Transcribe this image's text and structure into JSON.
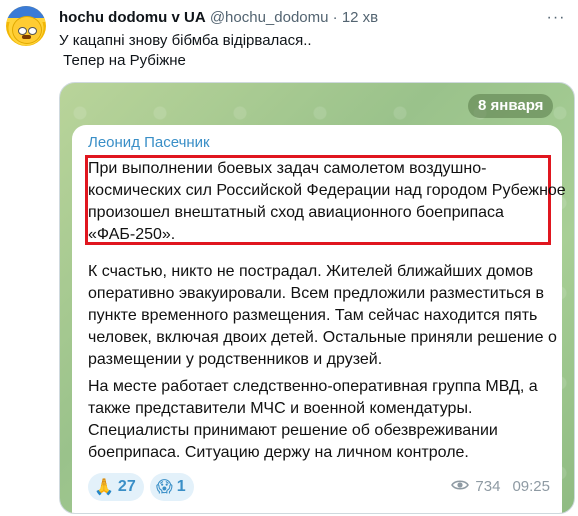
{
  "tweet": {
    "display_name": "hochu dodomu v UA",
    "handle": "@hochu_dodomu",
    "separator": "·",
    "time": "12 хв",
    "more_label": "···",
    "text": "У кацапні знову бібмба відірвалася..\n Тепер на Рубіжне"
  },
  "telegram": {
    "date_pill": "8 января",
    "author": "Леонид Пасечник",
    "highlighted_paragraph": [
      "При выполнении боевых задач самолетом воздушно-",
      "космических сил Российской Федерации над городом Рубежное",
      "произошел внештатный сход авиационного боеприпаса",
      "«ФАБ-250»."
    ],
    "paragraph_2": [
      "К счастью, никто не пострадал. Жителей ближайших домов",
      "оперативно эвакуировали. Всем предложили разместиться в",
      "пункте временного размещения. Там сейчас находится пять",
      "человек, включая двоих детей. Остальные приняли решение о",
      "размещении у родственников и друзей."
    ],
    "paragraph_3": [
      "На месте работает следственно-оперативная группа МВД, а",
      "также представители МЧС и военной комендатуры.",
      "Специалисты принимают решение об обезвреживании",
      "боеприпаса. Ситуацию держу на личном контроле."
    ],
    "reactions": [
      {
        "emoji": "🙏",
        "count": "27"
      },
      {
        "emoji": "😱",
        "count": "1"
      }
    ],
    "views": "734",
    "time": "09:25",
    "highlight_color": "#e0161f",
    "author_color": "#3a8fc7"
  }
}
